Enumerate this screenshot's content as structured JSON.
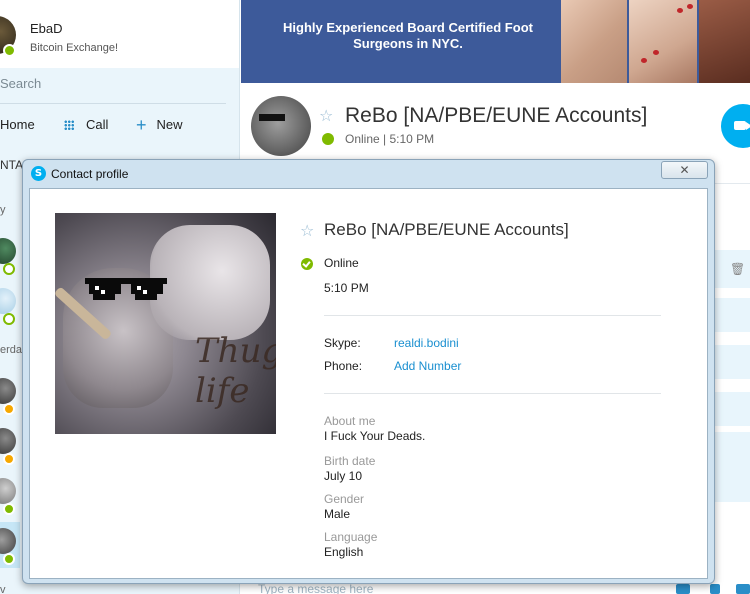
{
  "me": {
    "name": "EbaD",
    "mood": "Bitcoin Exchange!"
  },
  "sidebar": {
    "search_placeholder": "Search",
    "nav": {
      "home": "Home",
      "call": "Call",
      "new": "New"
    },
    "contacts_header": "NTAC",
    "group_today": "y",
    "group_yesterday": "erday",
    "group_bottom": "v"
  },
  "ad": {
    "text": "Highly Experienced Board Certified Foot Surgeons in NYC."
  },
  "chat": {
    "name": "ReBo [NA/PBE/EUNE Accounts]",
    "status_line": "Online | 5:10 PM",
    "composer_placeholder": "Type a message here"
  },
  "dialog": {
    "title": "Contact profile",
    "close_label": "✕",
    "name": "ReBo [NA/PBE/EUNE Accounts]",
    "status": "Online",
    "local_time": "5:10 PM",
    "skype_label": "Skype:",
    "skype_value": "realdi.bodini",
    "phone_label": "Phone:",
    "phone_value": "Add Number",
    "about_label": "About me",
    "about_value": "I Fuck Your Deads.",
    "birth_label": "Birth date",
    "birth_value": "July 10",
    "gender_label": "Gender",
    "gender_value": "Male",
    "language_label": "Language",
    "language_value": "English",
    "photo_tattoo": "Thug life"
  },
  "colors": {
    "accent": "#00aff0",
    "online": "#7fba00",
    "away": "#f6a800",
    "link": "#1a8fd0"
  },
  "icons": [
    "search-icon",
    "home-icon",
    "dialpad-icon",
    "plus-icon",
    "star-icon",
    "video-call-icon",
    "trash-icon",
    "skype-logo-icon",
    "close-icon"
  ]
}
